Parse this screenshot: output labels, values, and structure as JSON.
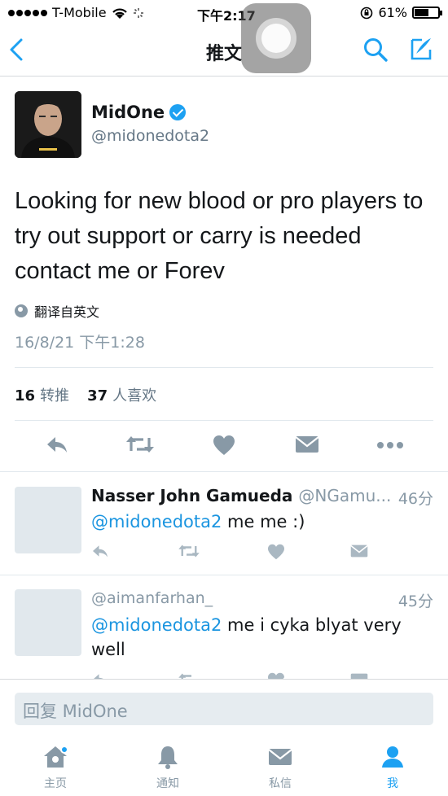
{
  "status_bar": {
    "carrier": "T-Mobile",
    "time": "下午2:17",
    "battery": "61%",
    "battery_level": 0.61
  },
  "nav": {
    "title": "推文"
  },
  "tweet": {
    "author_name": "MidOne",
    "author_handle": "@midonedota2",
    "text": "Looking for new blood or pro players to try out support or carry is needed contact me or Forev",
    "translate_label": "翻译自英文",
    "timestamp": "16/8/21 下午1:28",
    "retweet_count": "16",
    "retweet_label": "转推",
    "like_count": "37",
    "like_label": "人喜欢"
  },
  "replies": [
    {
      "name": "Nasser John Gamueda",
      "handle": "@NGamu...",
      "time": "46分",
      "mention": "@midonedota2",
      "text": " me me :)"
    },
    {
      "handle": "@aimanfarhan_",
      "time": "45分",
      "mention": "@midonedota2",
      "text": " me i cyka blyat very well"
    }
  ],
  "reply_box": {
    "placeholder": "回复 MidOne"
  },
  "tabs": [
    {
      "label": "主页",
      "icon": "home-icon"
    },
    {
      "label": "通知",
      "icon": "bell-icon"
    },
    {
      "label": "私信",
      "icon": "envelope-icon"
    },
    {
      "label": "我",
      "icon": "person-icon"
    }
  ],
  "colors": {
    "accent": "#1da1f2",
    "mention": "#1b95e0",
    "muted": "#8899a6",
    "action_gray": "#8899a6"
  }
}
